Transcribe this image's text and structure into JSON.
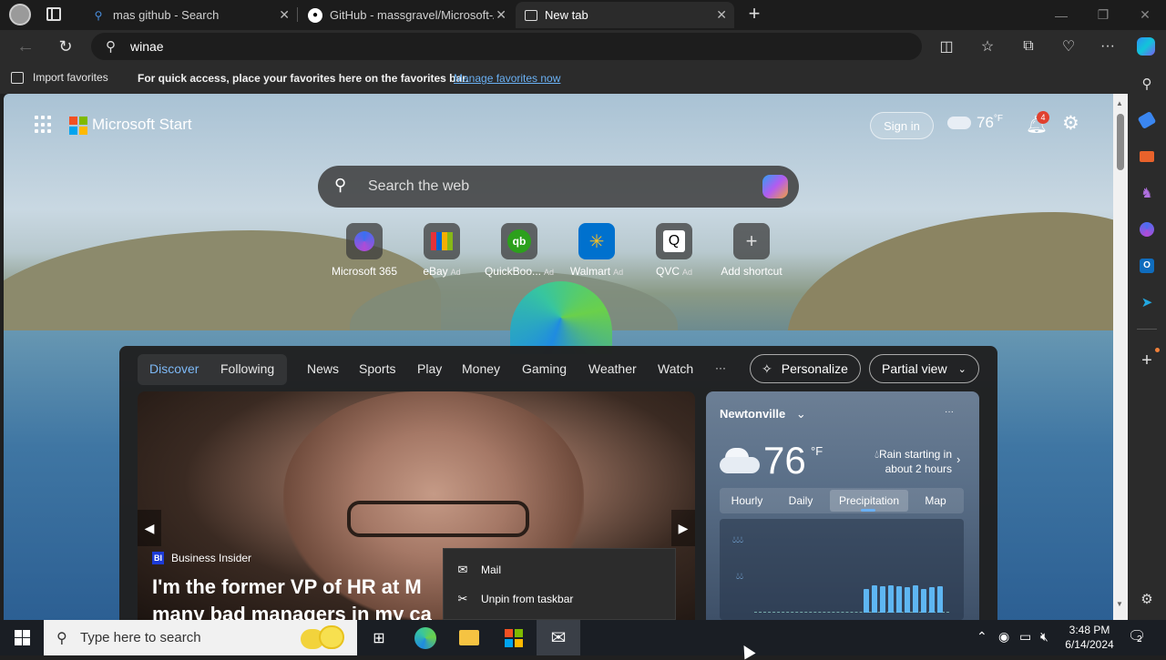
{
  "tabs": [
    {
      "title": "mas github - Search",
      "icon": "bing-search-icon"
    },
    {
      "title": "GitHub - massgravel/Microsoft-A",
      "icon": "github-icon"
    },
    {
      "title": "New tab",
      "icon": "new-tab-page-icon"
    }
  ],
  "address_bar": {
    "value": "winae"
  },
  "favorites_bar": {
    "import_label": "Import favorites",
    "message": "For quick access, place your favorites here on the favorites bar.",
    "link": "Manage favorites now"
  },
  "start": {
    "brand": "Microsoft Start",
    "sign_in": "Sign in",
    "temp": "76",
    "temp_unit": "°F",
    "notification_count": "4"
  },
  "search": {
    "placeholder": "Search the web"
  },
  "shortcuts": [
    {
      "label": "Microsoft 365",
      "ad": ""
    },
    {
      "label": "eBay",
      "ad": "Ad"
    },
    {
      "label": "QuickBoo...",
      "ad": "Ad"
    },
    {
      "label": "Walmart",
      "ad": "Ad"
    },
    {
      "label": "QVC",
      "ad": "Ad"
    },
    {
      "label": "Add shortcut",
      "ad": ""
    }
  ],
  "feed_nav": {
    "discover": "Discover",
    "following": "Following",
    "items": [
      "News",
      "Sports",
      "Play",
      "Money",
      "Gaming",
      "Weather",
      "Watch"
    ],
    "more": "···",
    "personalize": "Personalize",
    "partial_view": "Partial view"
  },
  "news": {
    "source_badge": "BI",
    "source": "Business Insider",
    "headline_1": "I'm the former VP of HR at M",
    "headline_2": "many bad managers in my ca"
  },
  "weather": {
    "location": "Newtonville",
    "more": "···",
    "temp": "76",
    "unit": "°F",
    "alert_1": "Rain starting in",
    "alert_2": "about 2 hours",
    "tabs": [
      "Hourly",
      "Daily",
      "Precipitation",
      "Map"
    ],
    "active_tab": "Precipitation"
  },
  "context_menu": {
    "items": [
      {
        "label": "Mail",
        "icon": "mail-icon"
      },
      {
        "label": "Unpin from taskbar",
        "icon": "unpin-icon"
      }
    ]
  },
  "taskbar": {
    "search_placeholder": "Type here to search",
    "time": "3:48 PM",
    "date": "6/14/2024",
    "notification_count": "2"
  },
  "colors": {
    "accent_blue": "#6ab0f3",
    "taskbar": "#1a1e24",
    "browser_chrome": "#2b2b2b"
  }
}
